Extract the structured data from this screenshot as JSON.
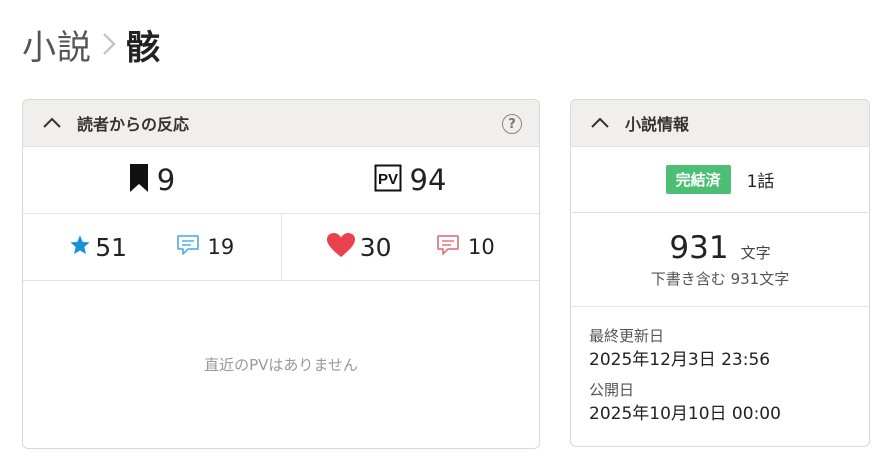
{
  "breadcrumb": {
    "parent": "小説",
    "current": "骸"
  },
  "reactions": {
    "title": "読者からの反応",
    "bookmarks": "9",
    "pv_label": "PV",
    "pv": "94",
    "stars": "51",
    "star_comments": "19",
    "hearts": "30",
    "heart_comments": "10",
    "empty_message": "直近のPVはありません",
    "help": "?"
  },
  "novel_info": {
    "title": "小説情報",
    "status_badge": "完結済",
    "episodes": "1話",
    "word_count": "931",
    "word_unit": "文字",
    "draft_note": "下書き含む 931文字",
    "updated_label": "最終更新日",
    "updated_value": "2025年12月3日 23:56",
    "published_label": "公開日",
    "published_value": "2025年10月10日 00:00"
  },
  "colors": {
    "star": "#1a8fd6",
    "star_comment": "#5fb4e6",
    "heart": "#e8424f",
    "heart_comment": "#e67b84",
    "badge": "#4cbf74"
  },
  "icons": [
    "chevron-right-icon",
    "chevron-up-icon",
    "help-icon",
    "bookmark-icon",
    "pv-icon",
    "star-icon",
    "comment-icon",
    "heart-icon"
  ]
}
